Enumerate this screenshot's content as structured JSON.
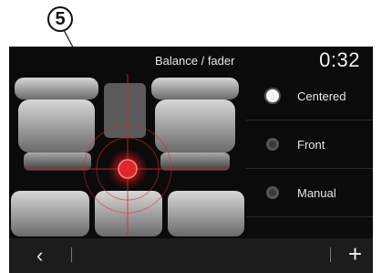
{
  "callout": {
    "number": "5"
  },
  "header": {
    "title": "Balance / fader",
    "clock": "0:32"
  },
  "seat_view": {
    "marker_icon": "sound-focus-target-icon"
  },
  "options": [
    {
      "label": "Centered",
      "selected": true
    },
    {
      "label": "Front",
      "selected": false
    },
    {
      "label": "Manual",
      "selected": false
    }
  ],
  "footer": {
    "back_icon": "chevron-left-icon",
    "add_icon": "plus-icon"
  },
  "colors": {
    "accent": "#e0262b",
    "background": "#0b0b0b",
    "text": "#e6e6e6"
  }
}
